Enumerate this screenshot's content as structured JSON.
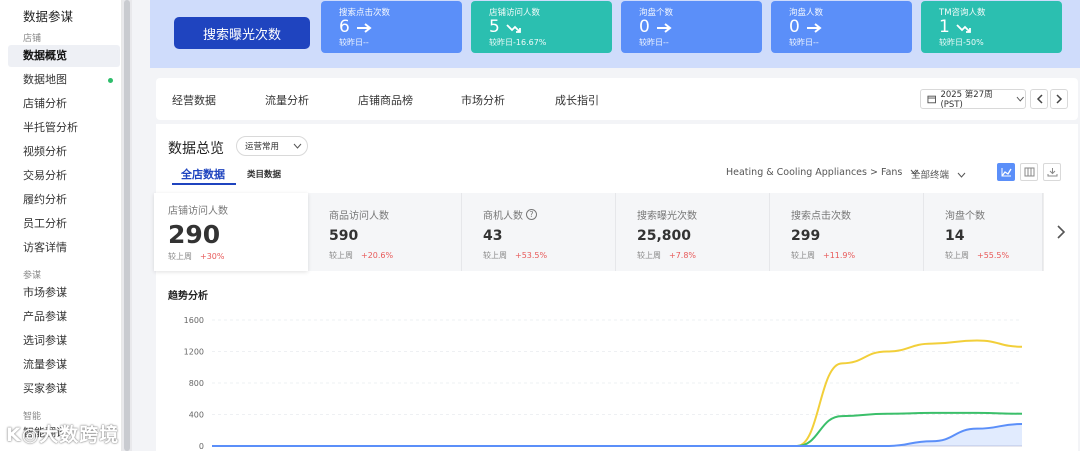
{
  "sidebar": {
    "title": "数据参谋",
    "group1": "店铺",
    "items1": [
      "数据概览",
      "数据地图",
      "店铺分析",
      "半托管分析",
      "视频分析",
      "交易分析",
      "履约分析",
      "员工分析",
      "访客详情"
    ],
    "group2": "参谋",
    "items2": [
      "市场参谋",
      "产品参谋",
      "选词参谋",
      "流量参谋",
      "买家参谋"
    ],
    "group3": "智能",
    "items3": [
      "智能翻译"
    ],
    "watermark": "K◎大数跨境"
  },
  "banner": {
    "main_button": "搜索曝光次数",
    "tiles": [
      {
        "title": "搜索点击次数",
        "value": "6",
        "sub": "较昨日--"
      },
      {
        "title": "店铺访问人数",
        "value": "5",
        "sub": "较昨日-16.67%"
      },
      {
        "title": "洵盘个数",
        "value": "0",
        "sub": "较昨日--"
      },
      {
        "title": "洵盘人数",
        "value": "0",
        "sub": "较昨日--"
      },
      {
        "title": "TM咨询人数",
        "value": "1",
        "sub": "较昨日-50%"
      }
    ]
  },
  "tabs": [
    "经营数据",
    "流量分析",
    "店铺商品榜",
    "市场分析",
    "成长指引"
  ],
  "week_selector": "2025 第27周 (PST)",
  "overview": {
    "title": "数据总览",
    "select": "运营常用",
    "subtab_active": "全店数据",
    "subtab_other": "类目数据",
    "category": "Heating & Cooling Appliances > Fans",
    "terminal": "全部终端"
  },
  "metrics": [
    {
      "label": "店铺访问人数",
      "value": "290",
      "compare": "较上周",
      "change": "+30%"
    },
    {
      "label": "商品访问人数",
      "value": "590",
      "compare": "较上周",
      "change": "+20.6%"
    },
    {
      "label": "商机人数",
      "value": "43",
      "compare": "较上周",
      "change": "+53.5%"
    },
    {
      "label": "搜索曝光次数",
      "value": "25,800",
      "compare": "较上周",
      "change": "+7.8%"
    },
    {
      "label": "搜索点击次数",
      "value": "299",
      "compare": "较上周",
      "change": "+11.9%"
    },
    {
      "label": "洵盘个数",
      "value": "14",
      "compare": "较上周",
      "change": "+55.5%"
    }
  ],
  "trend_title": "趋势分析",
  "chart_data": {
    "type": "line",
    "ylim": [
      0,
      1600
    ],
    "yticks": [
      0,
      400,
      800,
      1200,
      1600
    ],
    "series": [
      {
        "color": "#f2cf3a",
        "values": [
          0,
          0,
          0,
          0,
          0,
          0,
          0,
          0,
          0,
          0,
          0,
          0,
          0,
          0,
          1050,
          1200,
          1300,
          1340,
          1260
        ]
      },
      {
        "color": "#3bbf6a",
        "values": [
          0,
          0,
          0,
          0,
          0,
          0,
          0,
          0,
          0,
          0,
          0,
          0,
          0,
          0,
          380,
          410,
          420,
          420,
          410
        ]
      },
      {
        "color": "#5b8ff9",
        "values": [
          0,
          0,
          0,
          0,
          0,
          0,
          0,
          0,
          0,
          0,
          0,
          0,
          0,
          0,
          0,
          0,
          60,
          220,
          280
        ]
      }
    ]
  }
}
